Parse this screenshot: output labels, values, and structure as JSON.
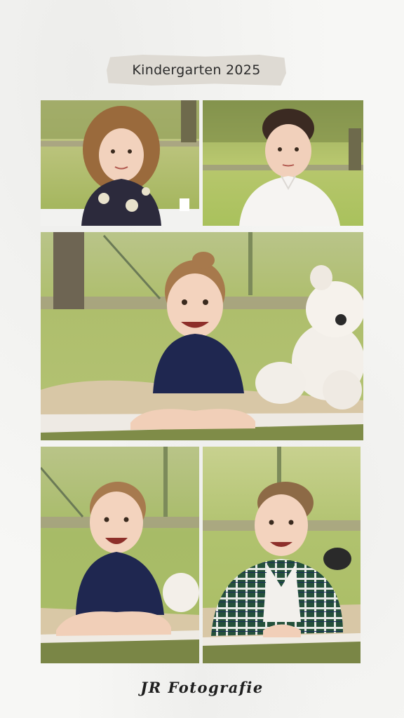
{
  "header": {
    "title": "Kindergarten 2025"
  },
  "footer": {
    "signature": "JR Fotografie"
  },
  "photos": [
    {
      "subject": "girl with curly hair in floral dress"
    },
    {
      "subject": "boy in white shirt"
    },
    {
      "subject": "smiling girl lying on blanket with teddy bear"
    },
    {
      "subject": "laughing girl lying on blanket"
    },
    {
      "subject": "smiling boy in plaid shirt lying on blanket"
    }
  ]
}
